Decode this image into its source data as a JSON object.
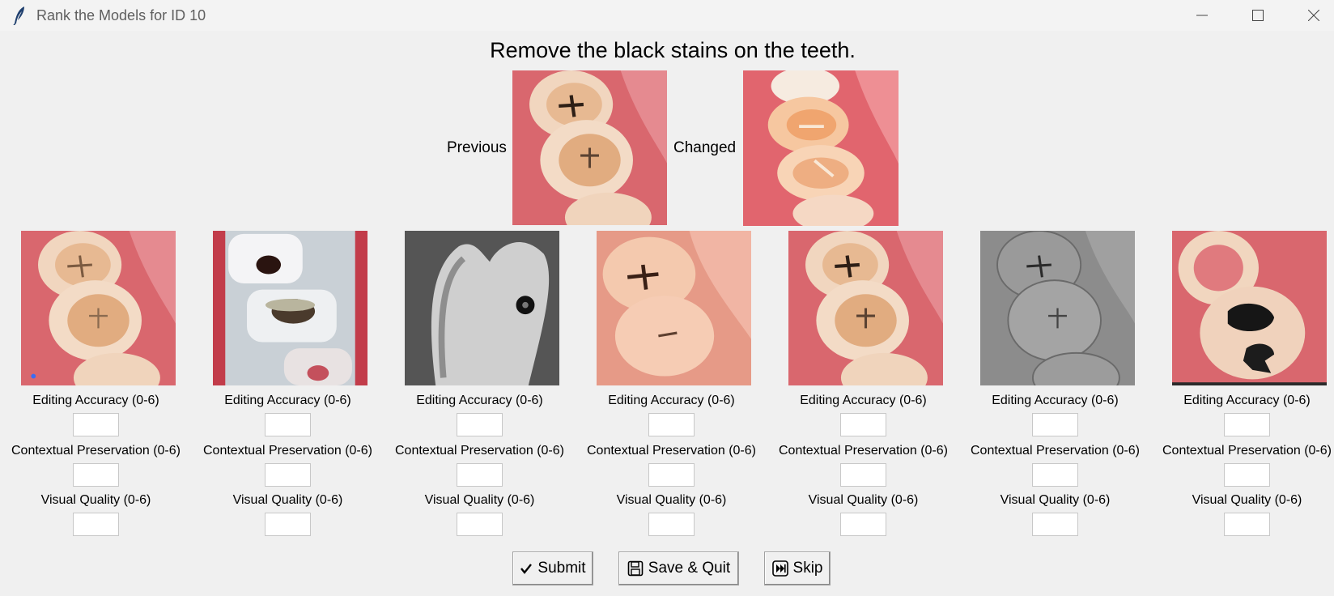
{
  "window": {
    "title": "Rank the Models for ID 10"
  },
  "instruction": "Remove the black stains on the teeth.",
  "reference": {
    "previous_label": "Previous",
    "changed_label": "Changed"
  },
  "criteria": {
    "editing": "Editing Accuracy (0-6)",
    "contextual": "Contextual Preservation (0-6)",
    "visual": "Visual Quality (0-6)"
  },
  "models": [
    {
      "editing": "",
      "contextual": "",
      "visual": ""
    },
    {
      "editing": "",
      "contextual": "",
      "visual": ""
    },
    {
      "editing": "",
      "contextual": "",
      "visual": ""
    },
    {
      "editing": "",
      "contextual": "",
      "visual": ""
    },
    {
      "editing": "",
      "contextual": "",
      "visual": ""
    },
    {
      "editing": "",
      "contextual": "",
      "visual": ""
    },
    {
      "editing": "",
      "contextual": "",
      "visual": ""
    }
  ],
  "buttons": {
    "submit": "Submit",
    "save_quit": "Save & Quit",
    "skip": "Skip"
  },
  "colors": {
    "gum": "#d9676e",
    "tooth": "#f1d6bf",
    "tooth_shadow": "#d8a276",
    "stain": "#2e1f16",
    "background": "#f0f0f0"
  }
}
